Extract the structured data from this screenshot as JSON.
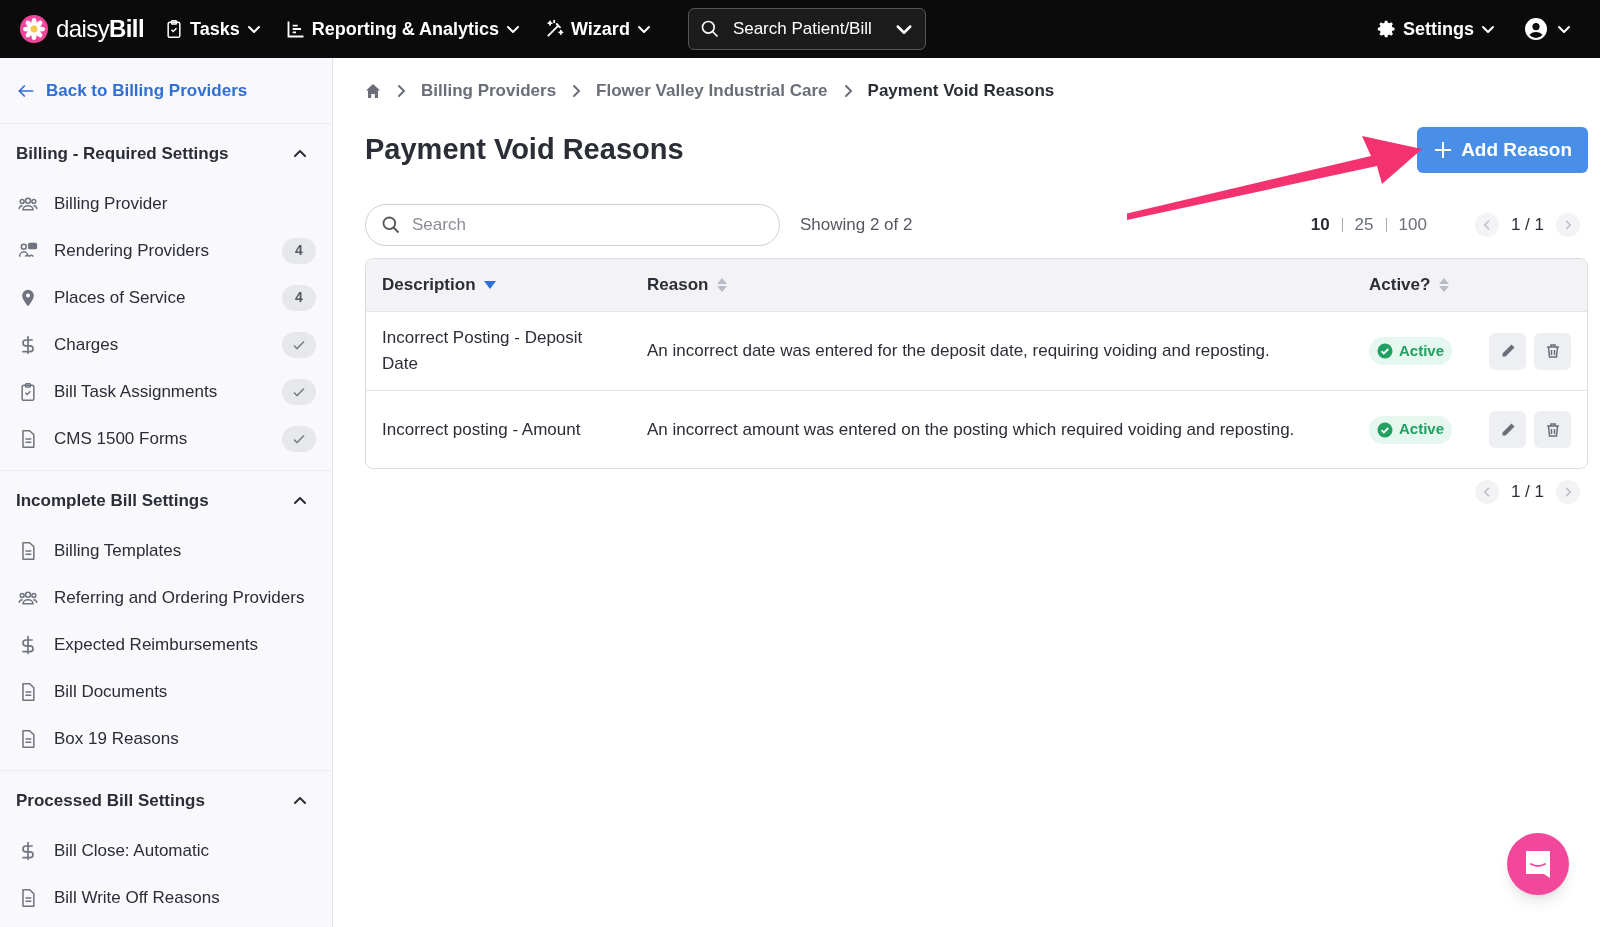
{
  "topbar": {
    "logo": {
      "prefix": "daisy",
      "suffix": "Bill"
    },
    "menus": [
      {
        "label": "Tasks",
        "kind": "clipboard"
      },
      {
        "label": "Reporting & Analytics",
        "kind": "chart"
      },
      {
        "label": "Wizard",
        "kind": "wand"
      }
    ],
    "search": {
      "placeholder": "Search Patient/Bill"
    },
    "settings": {
      "label": "Settings"
    }
  },
  "sidebar": {
    "back_link": "Back to Billing Providers",
    "sections": [
      {
        "title": "Billing - Required Settings",
        "expanded": true,
        "items": [
          {
            "label": "Billing Provider",
            "kind": "people"
          },
          {
            "label": "Rendering Providers",
            "kind": "presenter",
            "badge": {
              "kind": "count",
              "text": "4"
            }
          },
          {
            "label": "Places of Service",
            "kind": "pin",
            "badge": {
              "kind": "count",
              "text": "4"
            }
          },
          {
            "label": "Charges",
            "kind": "dollar",
            "badge": {
              "kind": "check"
            }
          },
          {
            "label": "Bill Task Assignments",
            "kind": "clipboard",
            "badge": {
              "kind": "check"
            }
          },
          {
            "label": "CMS 1500 Forms",
            "kind": "document",
            "badge": {
              "kind": "check"
            }
          }
        ]
      },
      {
        "title": "Incomplete Bill Settings",
        "expanded": true,
        "items": [
          {
            "label": "Billing Templates",
            "kind": "document"
          },
          {
            "label": "Referring and Ordering Providers",
            "kind": "people"
          },
          {
            "label": "Expected Reimbursements",
            "kind": "dollar"
          },
          {
            "label": "Bill Documents",
            "kind": "document"
          },
          {
            "label": "Box 19 Reasons",
            "kind": "document"
          }
        ]
      },
      {
        "title": "Processed Bill Settings",
        "expanded": true,
        "items": [
          {
            "label": "Bill Close: Automatic",
            "kind": "dollar"
          },
          {
            "label": "Bill Write Off Reasons",
            "kind": "document"
          }
        ]
      }
    ]
  },
  "breadcrumb": [
    "Billing Providers",
    "Flower Valley Industrial Care",
    "Payment Void Reasons"
  ],
  "page_title": "Payment Void Reasons",
  "add_button": "Add Reason",
  "search": {
    "placeholder": "Search"
  },
  "showing": "Showing 2 of 2",
  "page_sizes": [
    {
      "label": "10",
      "selected": true
    },
    {
      "label": "25",
      "selected": false
    },
    {
      "label": "100",
      "selected": false
    }
  ],
  "pager": "1 / 1",
  "table": {
    "columns": [
      {
        "label": "Description",
        "sorted": true
      },
      {
        "label": "Reason",
        "sorted": false
      },
      {
        "label": "Active?",
        "sorted": false
      }
    ],
    "rows": [
      {
        "description": "Incorrect Posting - Deposit Date",
        "reason": "An incorrect date was entered for the deposit date, requiring voiding and reposting.",
        "status": "Active",
        "active": true
      },
      {
        "description": "Incorrect posting - Amount",
        "reason": "An incorrect amount was entered on the posting which required voiding and reposting.",
        "status": "Active",
        "active": true
      }
    ]
  },
  "bottom_pager": "1 / 1"
}
